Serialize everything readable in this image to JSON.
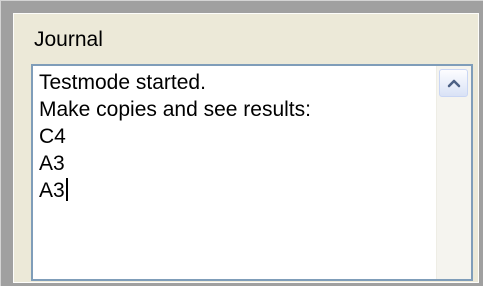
{
  "journal": {
    "title": "Journal",
    "lines": [
      "Testmode started.",
      "Make copies and see results:",
      "C4",
      "A3",
      "A3"
    ]
  },
  "icons": {
    "scroll_up": "chevron-up-icon"
  },
  "colors": {
    "panel_background": "#ece9d8",
    "frame": "#a0a0a0",
    "textbox_border": "#7f9db9",
    "scrollbar_track": "#f5f4ef",
    "arrow": "#4d6185"
  }
}
